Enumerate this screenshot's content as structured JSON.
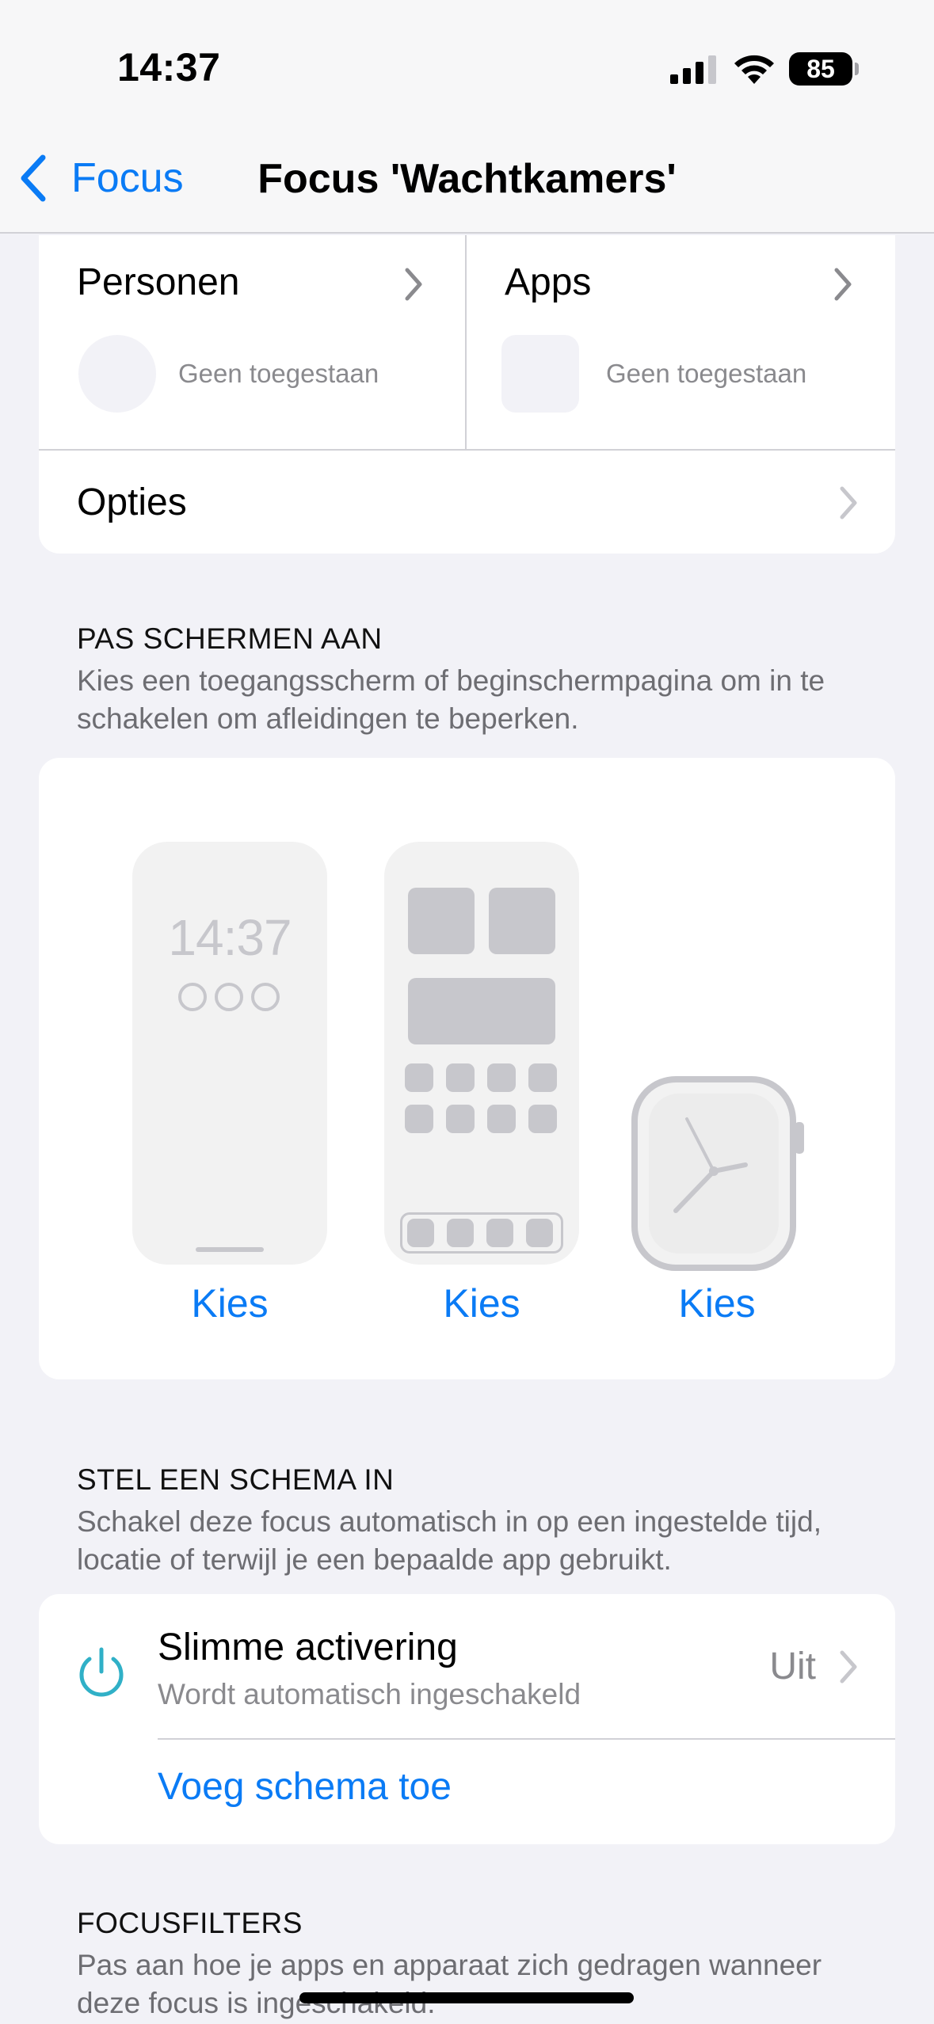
{
  "status_bar": {
    "time": "14:37",
    "battery": "85"
  },
  "nav": {
    "back_label": "Focus",
    "title": "Focus 'Wachtkamers'"
  },
  "allowed": {
    "people": {
      "title": "Personen",
      "subtitle": "Geen toegestaan"
    },
    "apps": {
      "title": "Apps",
      "subtitle": "Geen toegestaan"
    },
    "options_label": "Opties"
  },
  "screens": {
    "header": "PAS SCHERMEN AAN",
    "description": "Kies een toegangsscherm of beginschermpagina om in te schakelen om afleidingen te beperken.",
    "lock_time": "14:37",
    "choose_lock": "Kies",
    "choose_home": "Kies",
    "choose_watch": "Kies"
  },
  "schedule": {
    "header": "STEL EEN SCHEMA IN",
    "description": "Schakel deze focus automatisch in op een ingestelde tijd, locatie of terwijl je een bepaalde app gebruikt.",
    "smart_title": "Slimme activering",
    "smart_subtitle": "Wordt automatisch ingeschakeld",
    "smart_value": "Uit",
    "add_label": "Voeg schema toe"
  },
  "filters": {
    "header": "FOCUSFILTERS",
    "description": "Pas aan hoe je apps en apparaat zich gedragen wanneer deze focus is ingeschakeld."
  },
  "colors": {
    "accent": "#0a7bf5",
    "power_icon": "#30b0c7",
    "secondary_text": "#8a8a8e"
  }
}
